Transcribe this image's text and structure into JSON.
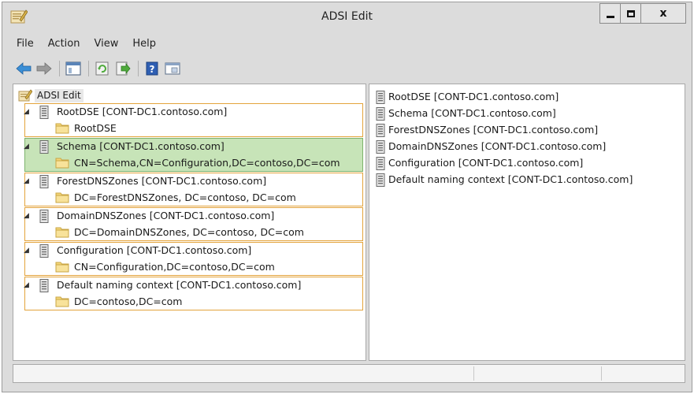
{
  "window": {
    "title": "ADSI Edit"
  },
  "menu": [
    "File",
    "Action",
    "View",
    "Help"
  ],
  "toolbar": {
    "buttons": [
      "back-arrow-icon",
      "forward-arrow-icon",
      "show-hide-tree-icon",
      "refresh-icon",
      "export-list-icon",
      "help-icon",
      "properties-icon"
    ]
  },
  "tree": {
    "root_label": "ADSI Edit",
    "nodes": [
      {
        "label": "RootDSE [CONT-DC1.contoso.com]",
        "child": "RootDSE",
        "selected": false
      },
      {
        "label": "Schema [CONT-DC1.contoso.com]",
        "child": "CN=Schema,CN=Configuration,DC=contoso,DC=com",
        "selected": true
      },
      {
        "label": "ForestDNSZones [CONT-DC1.contoso.com]",
        "child": "DC=ForestDNSZones, DC=contoso, DC=com",
        "selected": false
      },
      {
        "label": "DomainDNSZones [CONT-DC1.contoso.com]",
        "child": "DC=DomainDNSZones, DC=contoso, DC=com",
        "selected": false
      },
      {
        "label": "Configuration [CONT-DC1.contoso.com]",
        "child": "CN=Configuration,DC=contoso,DC=com",
        "selected": false
      },
      {
        "label": "Default naming context [CONT-DC1.contoso.com]",
        "child": "DC=contoso,DC=com",
        "selected": false
      }
    ]
  },
  "details": {
    "items": [
      "RootDSE [CONT-DC1.contoso.com]",
      "Schema [CONT-DC1.contoso.com]",
      "ForestDNSZones [CONT-DC1.contoso.com]",
      "DomainDNSZones [CONT-DC1.contoso.com]",
      "Configuration [CONT-DC1.contoso.com]",
      "Default naming context [CONT-DC1.contoso.com]"
    ]
  },
  "colors": {
    "node_border": "#e3a33b",
    "selected_bg": "#c7e4b8",
    "accent_blue": "#3b8fd6",
    "accent_green": "#4faa3c"
  }
}
